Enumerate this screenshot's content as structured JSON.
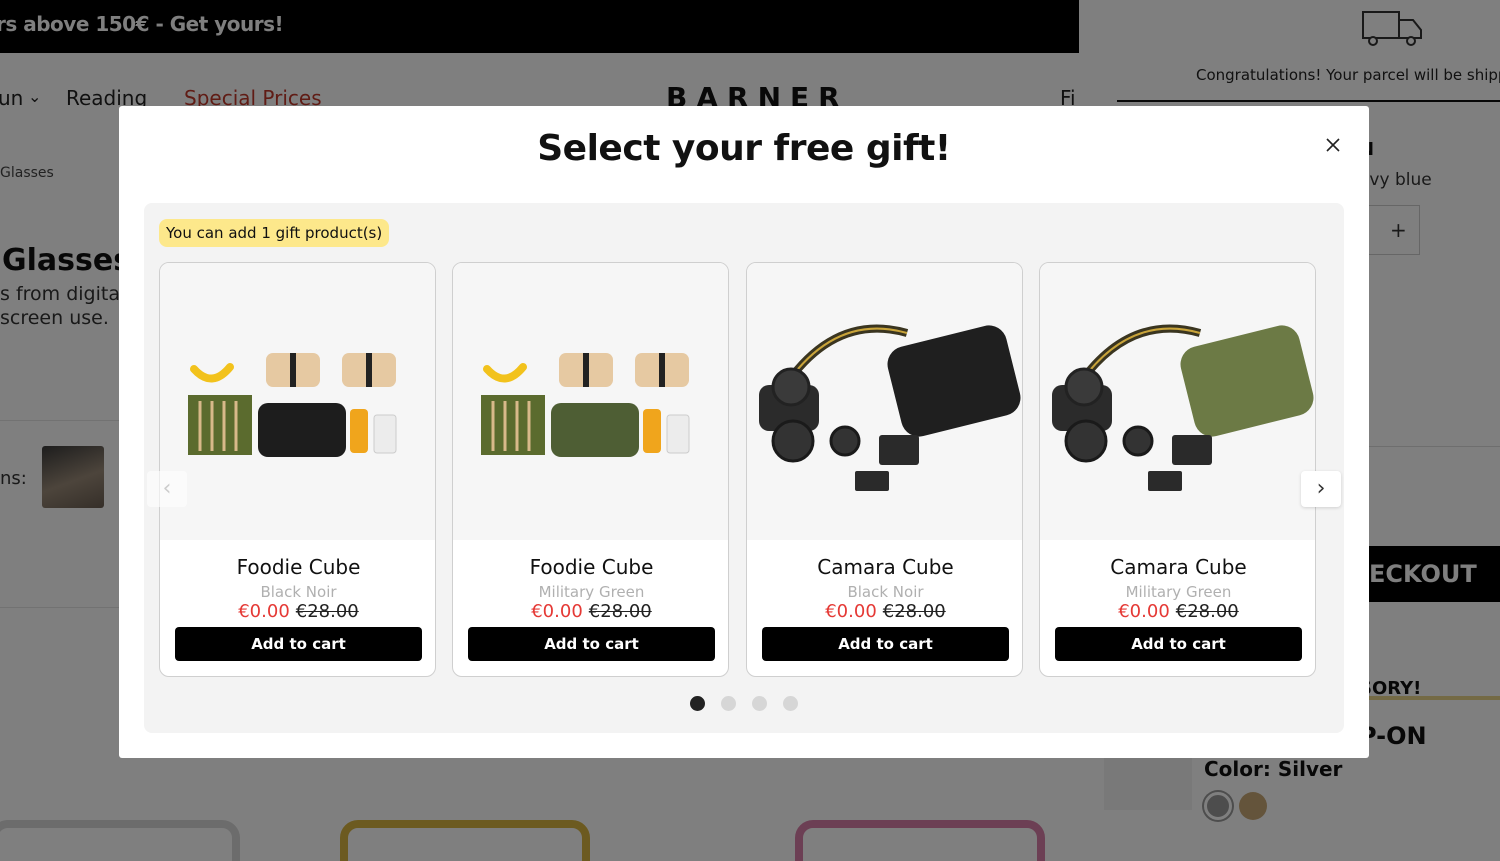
{
  "promo": {
    "text": "rs above 150€ - Get yours!"
  },
  "nav": {
    "items": [
      {
        "label": "un"
      },
      {
        "label": "Reading"
      },
      {
        "label": "Special Prices"
      }
    ],
    "brand": "BARNER",
    "right_label": "Fi"
  },
  "page": {
    "breadcrumb": "Glasses",
    "title": "Glasses",
    "description_line1": "s from digita",
    "description_line2": "screen use.",
    "review_label": "ns:"
  },
  "drawer": {
    "ship_message": "Congratulations! Your parcel will be shipp",
    "product_title": "N",
    "product_variant": "avy blue",
    "qty_plus": "+",
    "checkout_label": "ECKOUT",
    "accessory_heading": "SORY!",
    "accessory_title": "P-ON",
    "accessory_color": "Color: Silver",
    "swatches": [
      "#9a9a9a",
      "#c9a877"
    ]
  },
  "modal": {
    "title": "Select your free gift!",
    "close_icon": "close-icon",
    "badge": "You can add 1 gift product(s)",
    "prev_arrow": "‹",
    "next_arrow": "›",
    "products": [
      {
        "name": "Foodie Cube",
        "color": "Black Noir",
        "price": "€0.00",
        "old_price": "€28.00",
        "button": "Add to cart",
        "bag_color": "#1d1d1d"
      },
      {
        "name": "Foodie Cube",
        "color": "Military Green",
        "price": "€0.00",
        "old_price": "€28.00",
        "button": "Add to cart",
        "bag_color": "#4e5e34"
      },
      {
        "name": "Camara Cube",
        "color": "Black Noir",
        "price": "€0.00",
        "old_price": "€28.00",
        "button": "Add to cart",
        "bag_color": "#1f1f1f"
      },
      {
        "name": "Camara Cube",
        "color": "Military Green",
        "price": "€0.00",
        "old_price": "€28.00",
        "button": "Add to cart",
        "bag_color": "#6c7a45"
      }
    ],
    "pagination": {
      "total": 4,
      "active": 1
    }
  },
  "colors": {
    "accent_price": "#e53935",
    "badge_bg": "#fde88b",
    "overlay": "rgba(0,0,0,0.5)"
  }
}
